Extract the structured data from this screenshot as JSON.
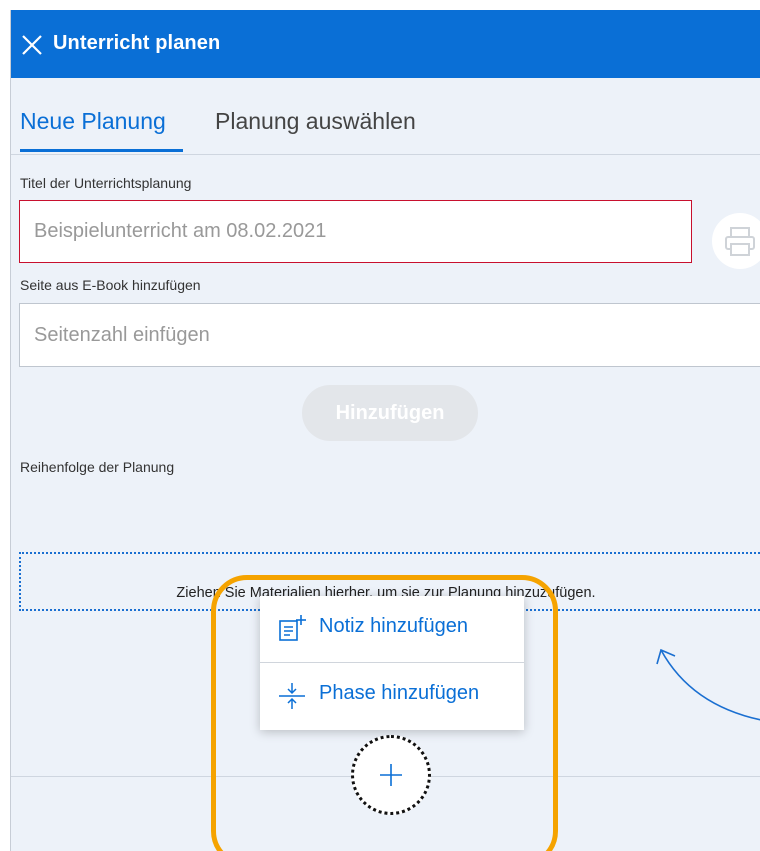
{
  "header": {
    "title": "Unterricht planen",
    "close_icon": "close-icon"
  },
  "tabs": [
    {
      "label": "Neue Planung",
      "active": true
    },
    {
      "label": "Planung auswählen",
      "active": false
    }
  ],
  "form": {
    "title_label": "Titel der Unterrichtsplanung",
    "title_placeholder": "Beispielunterricht am 08.02.2021",
    "page_label": "Seite aus E-Book hinzufügen",
    "page_placeholder": "Seitenzahl einfügen",
    "add_button": "Hinzufügen",
    "order_label": "Reihenfolge der Planung"
  },
  "dropzone": {
    "text": "Ziehen Sie Materialien hierher, um sie zur Planung hinzuzufügen."
  },
  "menu": {
    "items": [
      {
        "label": "Notiz hinzufügen",
        "icon": "add-note-icon"
      },
      {
        "label": "Phase hinzufügen",
        "icon": "add-phase-icon"
      }
    ]
  },
  "colors": {
    "primary": "#0a6fd6",
    "highlight": "#f5a300",
    "error_border": "#c8102e",
    "background": "#edf2f9"
  }
}
